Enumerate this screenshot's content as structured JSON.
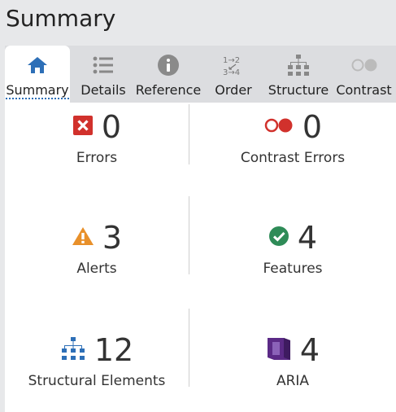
{
  "header": {
    "title": "Summary"
  },
  "tabs": [
    {
      "label": "Summary",
      "icon": "home-icon",
      "active": true
    },
    {
      "label": "Details",
      "icon": "list-icon",
      "active": false
    },
    {
      "label": "Reference",
      "icon": "info-icon",
      "active": false
    },
    {
      "label": "Order",
      "icon": "order-icon",
      "active": false
    },
    {
      "label": "Structure",
      "icon": "structure-icon",
      "active": false
    },
    {
      "label": "Contrast",
      "icon": "contrast-icon",
      "active": false
    }
  ],
  "summary": {
    "errors": {
      "count": "0",
      "label": "Errors",
      "icon": "error-icon",
      "color": "#d1312c"
    },
    "contrast_errors": {
      "count": "0",
      "label": "Contrast Errors",
      "icon": "contrast-error-icon",
      "color": "#d1312c"
    },
    "alerts": {
      "count": "3",
      "label": "Alerts",
      "icon": "alert-icon",
      "color": "#e8902a"
    },
    "features": {
      "count": "4",
      "label": "Features",
      "icon": "feature-check-icon",
      "color": "#2e8b57"
    },
    "structural": {
      "count": "12",
      "label": "Structural Elements",
      "icon": "structure-icon",
      "color": "#2d6fb7"
    },
    "aria": {
      "count": "4",
      "label": "ARIA",
      "icon": "aria-icon",
      "color": "#5b2a86"
    }
  },
  "colors": {
    "accent": "#2d6fb7",
    "tab_bg": "#dcdde0",
    "page_bg": "#e7e8ea"
  }
}
